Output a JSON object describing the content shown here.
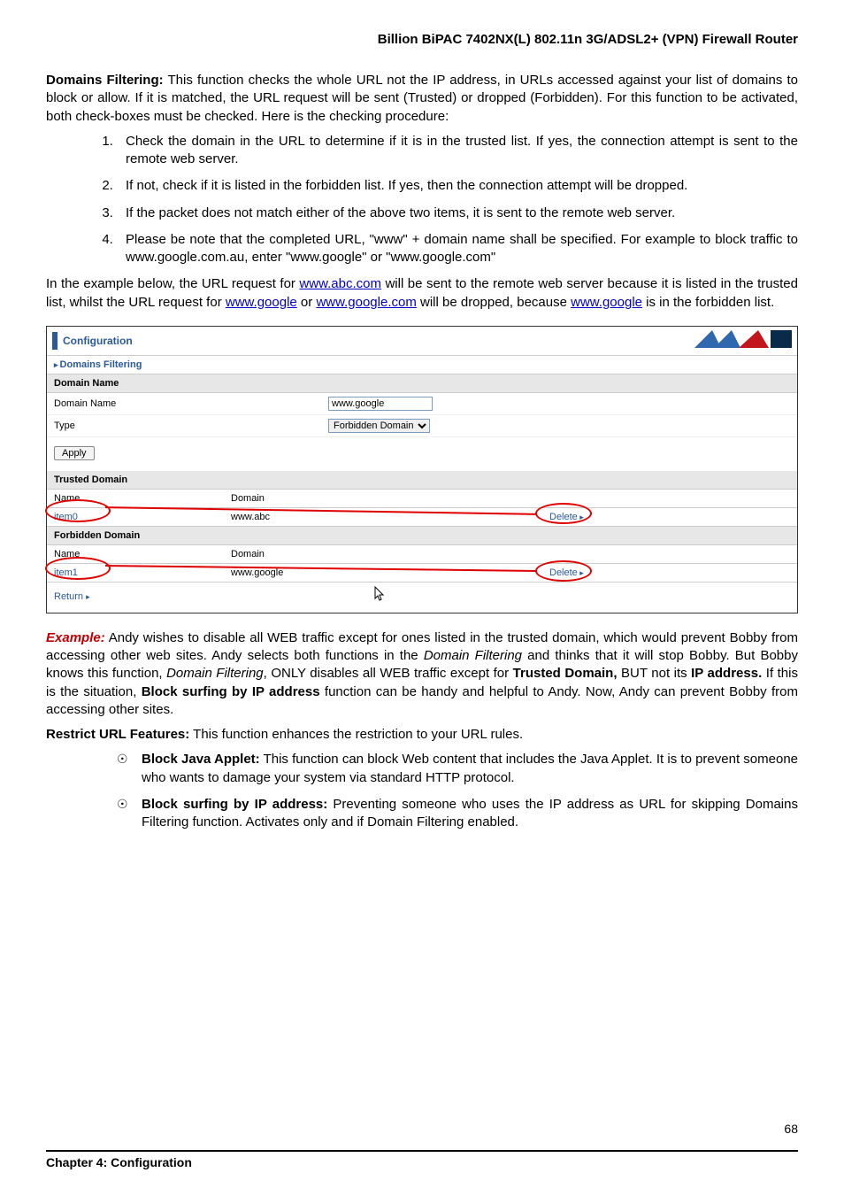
{
  "header": {
    "title": "Billion BiPAC 7402NX(L) 802.11n 3G/ADSL2+ (VPN) Firewall Router"
  },
  "intro": {
    "heading": "Domains Filtering:",
    "text": " This function checks the whole URL not the IP address, in URLs accessed against your list of domains to block or allow.    If it is matched, the URL request will be sent (Trusted) or dropped (Forbidden).    For this function to be activated, both check-boxes must be checked.    Here is the checking procedure:"
  },
  "steps": [
    "Check the domain in the URL to determine if it is in the trusted list. If yes, the connection attempt is sent to the remote web server.",
    "If not, check if it is listed in the forbidden list.  If yes, then the connection attempt will be dropped.",
    "If the packet does not match either of the above two items, it is sent to the remote web server."
  ],
  "step4": {
    "pre": "Please be note that the completed URL, \"www\" + domain name shall be specified. For example to block traffic to ",
    "link1": "www.google.com.au",
    "mid1": ", enter \"",
    "link2": "www.google",
    "mid2": "\" or \"",
    "link3": "www.google.com",
    "post": "\""
  },
  "below_example": {
    "pre": "In the example below, the URL request for ",
    "link1": "www.abc.com",
    "mid1": " will be sent to the remote web server because it is listed in the trusted list, whilst the URL request for ",
    "link2": "www.google",
    "mid2": " or ",
    "link3": "www.google.com",
    "mid3": " will be dropped, because ",
    "link4": "www.google",
    "post": " is in the forbidden list."
  },
  "config": {
    "panel_title": "Configuration",
    "section_title": "Domains Filtering",
    "domain_name_section": "Domain Name",
    "domain_name_label": "Domain Name",
    "domain_name_value": "www.google",
    "type_label": "Type",
    "type_value": "Forbidden Domain",
    "apply_label": "Apply",
    "trusted_section": "Trusted Domain",
    "forbidden_section": "Forbidden Domain",
    "col_name": "Name",
    "col_domain": "Domain",
    "trusted_rows": [
      {
        "name": "item0",
        "domain": "www.abc",
        "action": "Delete"
      }
    ],
    "forbidden_rows": [
      {
        "name": "item1",
        "domain": "www.google",
        "action": "Delete"
      }
    ],
    "return_label": "Return"
  },
  "example_para": {
    "label": "Example:",
    "t1": "  Andy wishes to disable all WEB traffic except for ones listed in the trusted domain, which would prevent Bobby from accessing other web sites.   Andy selects both functions in the ",
    "i1": "Domain Filtering",
    "t2": " and thinks that it will stop Bobby.   But Bobby knows this function, ",
    "i2": "Domain Filtering",
    "t3": ", ONLY disables all WEB traffic except for ",
    "b1": "Trusted Domain,",
    "t4": " BUT not its ",
    "b2": "IP address.",
    "t5": "   If this is the situation, ",
    "b3": "Block surfing by IP address",
    "t6": " function can be handy and helpful to Andy.    Now, Andy can prevent Bobby from accessing other sites."
  },
  "restrict": {
    "heading": "Restrict URL Features:",
    "text": " This function enhances the restriction to your URL rules."
  },
  "bullets": [
    {
      "heading": "Block Java Applet:",
      "text": " This function can block Web content that includes the Java Applet. It is to prevent someone who wants to damage your system via standard HTTP protocol."
    },
    {
      "heading": "Block surfing by IP address:",
      "text": " Preventing someone who uses the IP address as URL for skipping Domains Filtering function.    Activates only and if Domain Filtering enabled."
    }
  ],
  "footer": {
    "chapter": "Chapter 4: Configuration",
    "page": "68"
  }
}
